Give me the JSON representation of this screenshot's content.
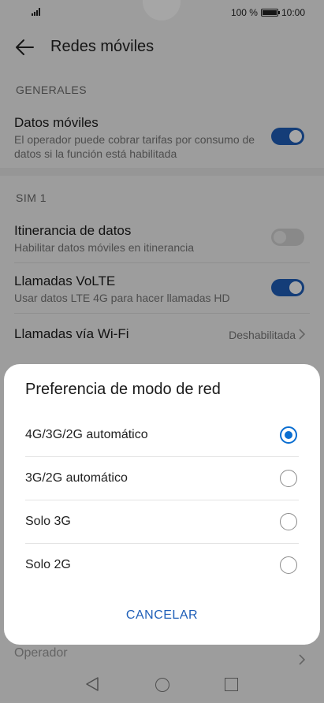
{
  "status": {
    "battery": "100 %",
    "time": "10:00",
    "battery_level": 1.0
  },
  "header": {
    "title": "Redes móviles"
  },
  "sections": {
    "general": "GENERALES",
    "sim1": "SIM 1"
  },
  "rows": {
    "datos_moviles": {
      "title": "Datos móviles",
      "sub": "El operador puede cobrar tarifas por consumo de datos si la función está habilitada",
      "on": true
    },
    "itinerancia": {
      "title": "Itinerancia de datos",
      "sub": "Habilitar datos móviles en itinerancia",
      "on": false
    },
    "volte": {
      "title": "Llamadas VoLTE",
      "sub": "Usar datos LTE 4G para hacer llamadas HD",
      "on": true
    },
    "wifi_calls": {
      "title": "Llamadas vía Wi-Fi",
      "value": "Deshabilitada"
    },
    "operador": {
      "title": "Operador"
    }
  },
  "dialog": {
    "title": "Preferencia de modo de red",
    "options": [
      {
        "label": "4G/3G/2G automático",
        "selected": true
      },
      {
        "label": "3G/2G automático",
        "selected": false
      },
      {
        "label": "Solo 3G",
        "selected": false
      },
      {
        "label": "Solo 2G",
        "selected": false
      }
    ],
    "cancel": "CANCELAR"
  },
  "colors": {
    "accent": "#1f5fb8",
    "radio": "#0a6ed1"
  }
}
